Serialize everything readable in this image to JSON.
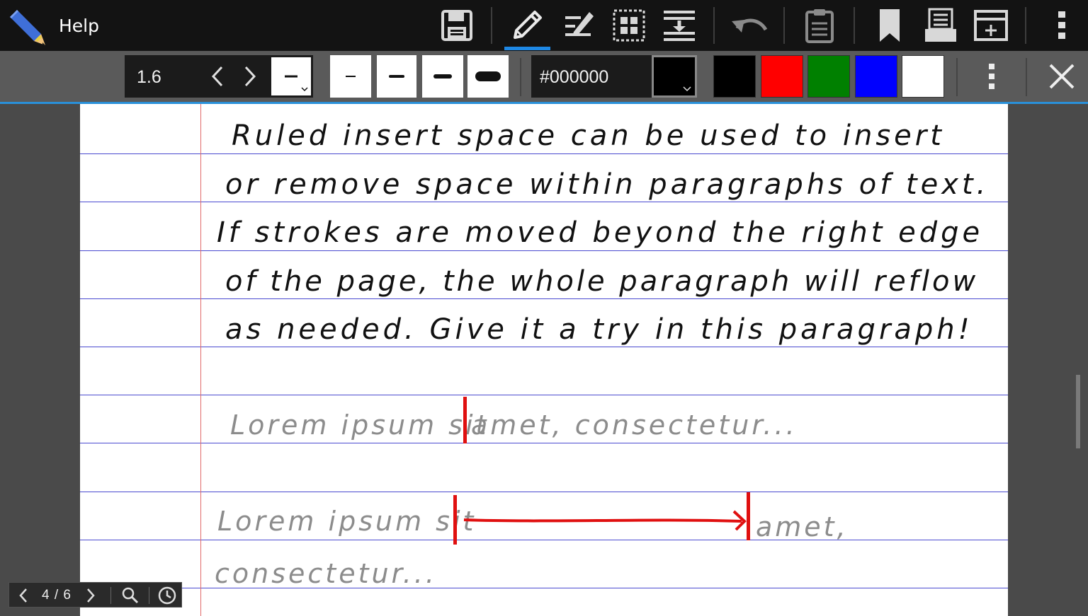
{
  "app": {
    "title": "Help",
    "logo_icon": "pencil-logo-icon"
  },
  "toolbar": {
    "icons": [
      "save-icon",
      "pen-icon",
      "ruled-insert-space-icon",
      "selection-icon",
      "insert-space-icon",
      "undo-icon",
      "clipboard-icon",
      "bookmark-icon",
      "stack-icon",
      "add-page-icon",
      "more-vert-icon"
    ],
    "active_tool": "pen"
  },
  "pen_options": {
    "width": "1.6",
    "hex_color": "#000000",
    "selected_color": "#000000",
    "swatches": [
      "#000000",
      "#ff0000",
      "#008000",
      "#0000ff",
      "#ffffff"
    ],
    "accent": "#1e88e5"
  },
  "document": {
    "lines": [
      "Ruled insert space can be used to insert",
      "or remove space within paragraphs of text.",
      "If strokes are moved beyond the right edge",
      "of the page, the whole paragraph will reflow",
      "as needed. Give it a try in this paragraph!"
    ],
    "example1": "Lorem ipsum sit|amet, consectetur...",
    "example1_part1": "Lorem ipsum sit",
    "example1_part2": "amet, consectetur...",
    "example2_part1": "Lorem ipsum sit",
    "example2_part2": "amet,",
    "example2_line2": "consectetur...",
    "ink_red": "#e01010",
    "ink_grey": "#8c8c8c"
  },
  "page_nav": {
    "label": "4 / 6",
    "current": 4,
    "total": 6
  }
}
